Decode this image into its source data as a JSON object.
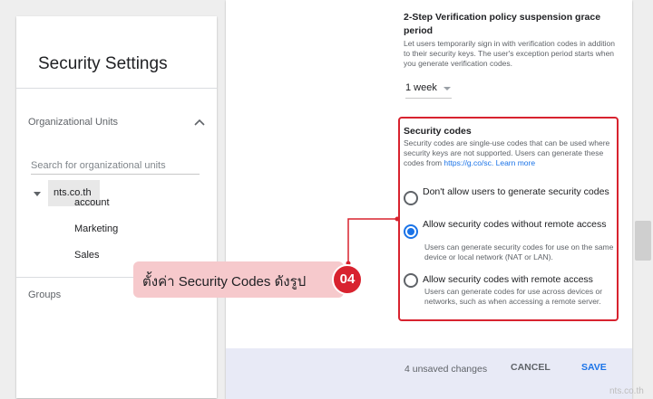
{
  "sidebar": {
    "title": "Security Settings",
    "org_units_label": "Organizational Units",
    "search_placeholder": "Search for organizational units",
    "root": "nts.co.th",
    "children": [
      "account",
      "Marketing",
      "Sales"
    ],
    "groups_label": "Groups"
  },
  "grace_period": {
    "title": "2-Step Verification policy suspension grace period",
    "description": "Let users temporarily sign in with verification codes in addition to their security keys. The user's exception period starts when you generate verification codes.",
    "selected": "1 week"
  },
  "security_codes": {
    "title": "Security codes",
    "description": "Security codes are single-use codes that can be used where security keys are not supported. Users can generate these codes from",
    "link_text": "https://g.co/sc.",
    "learn_more": "Learn more",
    "options": [
      {
        "label": "Don't allow users to generate security codes",
        "hint": "",
        "checked": false
      },
      {
        "label": "Allow security codes without remote access",
        "hint": "Users can generate security codes for use on the same device or local network (NAT or LAN).",
        "checked": true
      },
      {
        "label": "Allow security codes with remote access",
        "hint": "Users can generate codes for use across devices or networks, such as when accessing a remote server.",
        "checked": false
      }
    ]
  },
  "footer": {
    "unsaved": "4 unsaved changes",
    "cancel": "CANCEL",
    "save": "SAVE"
  },
  "annotation": {
    "text": "ตั้งค่า Security Codes ดังรูป",
    "badge": "04"
  },
  "watermark": "nts.co.th",
  "colors": {
    "accent": "#1a73e8",
    "highlight": "#d8232f",
    "callout_bg": "#f6c9cc",
    "footer_bg": "#e8eaf6"
  }
}
